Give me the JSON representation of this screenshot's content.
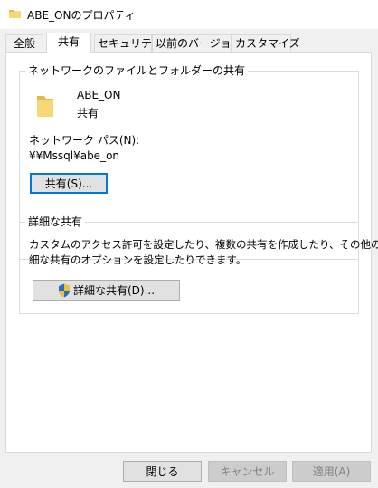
{
  "window": {
    "title": "ABE_ONのプロパティ"
  },
  "tabs": [
    {
      "label": "全般"
    },
    {
      "label": "共有"
    },
    {
      "label": "セキュリティ"
    },
    {
      "label": "以前のバージョン"
    },
    {
      "label": "カスタマイズ"
    }
  ],
  "network_share": {
    "legend": "ネットワークのファイルとフォルダーの共有",
    "folder_name": "ABE_ON",
    "folder_status": "共有",
    "path_label": "ネットワーク パス(N):",
    "path_value": "¥¥Mssql¥abe_on",
    "share_button": "共有(S)..."
  },
  "advanced_share": {
    "legend": "詳細な共有",
    "description_line1": "カスタムのアクセス許可を設定したり、複数の共有を作成したり、その他の詳",
    "description_line2": "細な共有のオプションを設定したりできます。",
    "button": "詳細な共有(D)..."
  },
  "footer": {
    "close": "閉じる",
    "cancel": "キャンセル",
    "apply": "適用(A)"
  },
  "colors": {
    "folder_yellow": "#f8d775",
    "focus_blue": "#0078d7",
    "shield_blue": "#2b6cc4",
    "shield_yellow": "#f2c230"
  }
}
